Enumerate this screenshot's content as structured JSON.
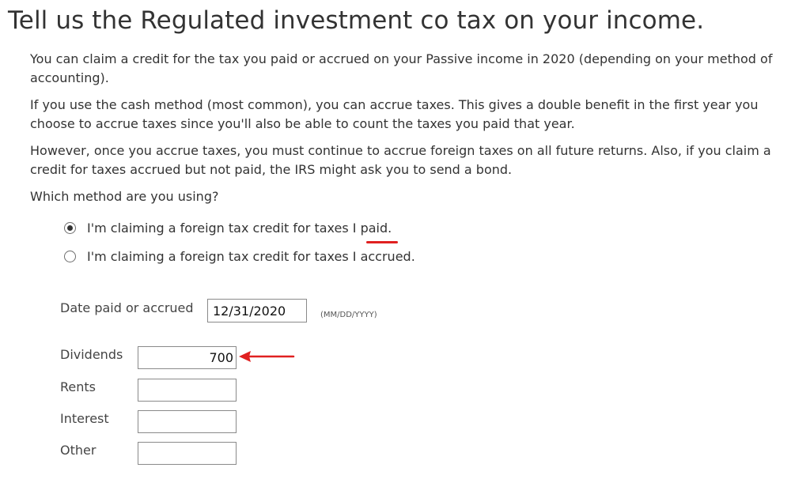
{
  "page": {
    "title": "Tell us the Regulated investment co tax on your income.",
    "paragraphs": [
      "You can claim a credit for the tax you paid or accrued on your Passive  income in 2020 (depending on your method of accounting).",
      "If you use the cash method (most common), you can accrue taxes. This gives a double benefit in the first year you choose to accrue taxes since you'll also be able to count the taxes you paid that year.",
      "However, once you accrue taxes, you must continue to accrue foreign taxes on all future returns. Also, if you claim a credit for taxes accrued but not paid, the IRS might ask you to send a bond.",
      "Which method are you using?"
    ]
  },
  "method": {
    "options": [
      {
        "label_prefix": "I'm claiming a foreign tax credit for taxes I ",
        "label_emphasis": "paid",
        "label_suffix": ".",
        "selected": true
      },
      {
        "label": "I'm claiming a foreign tax credit for taxes I accrued.",
        "selected": false
      }
    ]
  },
  "date_field": {
    "label": "Date paid or accrued",
    "value": "12/31/2020",
    "format_hint": "(MM/DD/YYYY)"
  },
  "amounts": [
    {
      "label": "Dividends",
      "value": "700"
    },
    {
      "label": "Rents",
      "value": ""
    },
    {
      "label": "Interest",
      "value": ""
    },
    {
      "label": "Other",
      "value": ""
    }
  ],
  "annotations": {
    "highlight_color": "#e02020"
  }
}
